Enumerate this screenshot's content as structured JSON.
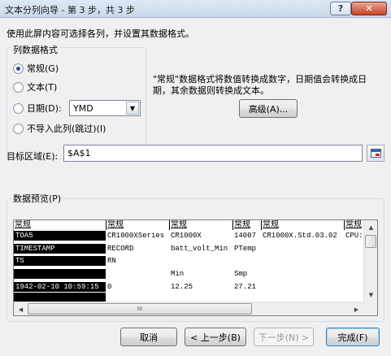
{
  "window": {
    "title": "文本分列向导 - 第 3 步，共 3 步",
    "help_label": "?",
    "close_label": "✕"
  },
  "instructions": "使用此屏内容可选择各列，并设置其数据格式。",
  "column_format": {
    "legend": "列数据格式",
    "options": [
      {
        "label": "常规(G)",
        "checked": true
      },
      {
        "label": "文本(T)",
        "checked": false
      },
      {
        "label": "日期(D):",
        "checked": false
      },
      {
        "label": "不导入此列(跳过)(I)",
        "checked": false
      }
    ],
    "date_format_value": "YMD"
  },
  "description": "\"常规\"数据格式将数值转换成数字，日期值会转换成日期，其余数据则转换成文本。",
  "advanced_button": "高级(A)...",
  "destination": {
    "label": "目标区域(E):",
    "value": "$A$1"
  },
  "preview": {
    "legend": "数据预览(P)",
    "headers": [
      "常规",
      "常规",
      "常规",
      "常规",
      "常规",
      "常规"
    ],
    "rows": [
      [
        "TOA5",
        "CR1000XSeries",
        "CR1000X",
        "14007",
        "CR1000X.Std.03.02",
        "CPU:"
      ],
      [
        "TIMESTAMP",
        "RECORD",
        "batt_volt_Min",
        "PTemp",
        "",
        ""
      ],
      [
        "TS",
        "RN",
        "",
        "",
        "",
        ""
      ],
      [
        "",
        "",
        "Min",
        "Smp",
        "",
        ""
      ],
      [
        "1942-02-10 10:59:15",
        "0",
        "12.25",
        "27.21",
        "",
        ""
      ]
    ],
    "hscroll_thumb": "III"
  },
  "footer": {
    "cancel": "取消",
    "back": "< 上一步(B)",
    "next": "下一步(N) >",
    "finish": "完成(F)"
  }
}
